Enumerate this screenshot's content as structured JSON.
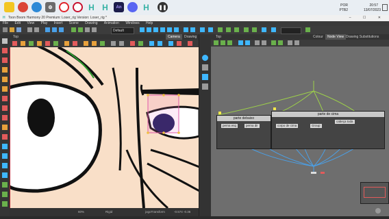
{
  "taskbar": {
    "icons": [
      {
        "name": "folder-icon",
        "color": "#f3c623"
      },
      {
        "name": "chrome-icon",
        "color": "#db4437"
      },
      {
        "name": "edge-icon",
        "color": "#2d89d6"
      },
      {
        "name": "settings-icon",
        "color": "#6b6b6b"
      },
      {
        "name": "opera-icon",
        "color": "#e0242b"
      },
      {
        "name": "opera-gx-icon",
        "color": "#c8102e"
      },
      {
        "name": "harmony-icon",
        "color": "#39b3a6"
      },
      {
        "name": "animate-icon",
        "color": "#1b1c4a"
      },
      {
        "name": "discord-icon",
        "color": "#5865f2"
      },
      {
        "name": "h-app-icon",
        "color": "#39b3a6"
      },
      {
        "name": "pause-icon",
        "color": "#333333"
      }
    ],
    "lang": "POR",
    "lang2": "PTB2",
    "time": "20:57",
    "date": "13/07/2023"
  },
  "window": {
    "title": "Toon Boom Harmony 20 Premium: Loser_rig Version: Loser_rig *"
  },
  "menu": [
    "File",
    "Edit",
    "View",
    "Play",
    "Insert",
    "Scene",
    "Drawing",
    "Animation",
    "Windows",
    "Help"
  ],
  "toolbar": {
    "mode_select": "Default"
  },
  "camera": {
    "tabs": [
      "Camera",
      "Drawing"
    ],
    "top_label": "Top",
    "zoom": "60%",
    "tool_label": "Rigid",
    "layer_name": "jogoTransform",
    "coords": "-0.574 -0.36"
  },
  "node_view": {
    "top_label": "Top",
    "tabs": [
      "Colour",
      "Node View",
      "Drawing Substitutions"
    ],
    "groups": [
      {
        "title": "parte debaixo",
        "nodes": [
          "perna esq",
          "perna dir"
        ]
      },
      {
        "title": "parte de cima",
        "nodes": [
          "corpo de cima",
          "Group",
          "cabeça toda"
        ]
      }
    ]
  },
  "colors": {
    "canvas": "#f9dfc8",
    "accent": "#3fb7ff",
    "node_bg": "#6e6e6e",
    "pupil": "#1a1a5a"
  }
}
